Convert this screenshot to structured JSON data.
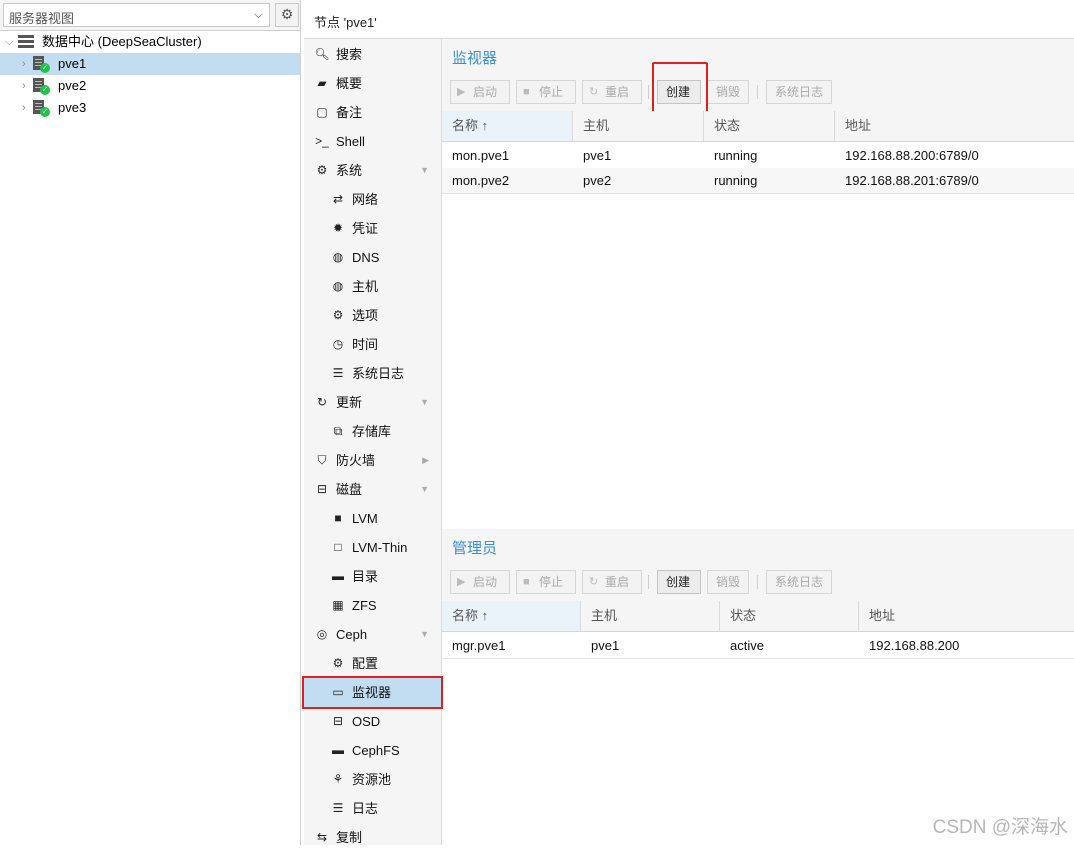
{
  "tree": {
    "view_label": "服务器视图",
    "datacenter": "数据中心 (DeepSeaCluster)",
    "nodes": [
      "pve1",
      "pve2",
      "pve3"
    ]
  },
  "header": {
    "title": "节点 'pve1'"
  },
  "nav": {
    "search": "搜索",
    "summary": "概要",
    "notes": "备注",
    "shell": "Shell",
    "system": "系统",
    "network": "网络",
    "certificates": "凭证",
    "dns": "DNS",
    "hosts": "主机",
    "options": "选项",
    "time": "时间",
    "syslog": "系统日志",
    "updates": "更新",
    "repos": "存储库",
    "firewall": "防火墙",
    "disks": "磁盘",
    "lvm": "LVM",
    "lvmthin": "LVM-Thin",
    "directory": "目录",
    "zfs": "ZFS",
    "ceph": "Ceph",
    "config": "配置",
    "monitor": "监视器",
    "osd": "OSD",
    "cephfs": "CephFS",
    "pools": "资源池",
    "log": "日志",
    "replication": "复制"
  },
  "monitors": {
    "title": "监视器",
    "toolbar": {
      "start": "启动",
      "stop": "停止",
      "restart": "重启",
      "create": "创建",
      "destroy": "销毁",
      "syslog": "系统日志"
    },
    "columns": {
      "name": "名称 ↑",
      "host": "主机",
      "status": "状态",
      "address": "地址"
    },
    "rows": [
      {
        "name": "mon.pve1",
        "host": "pve1",
        "status": "running",
        "address": "192.168.88.200:6789/0"
      },
      {
        "name": "mon.pve2",
        "host": "pve2",
        "status": "running",
        "address": "192.168.88.201:6789/0"
      }
    ]
  },
  "managers": {
    "title": "管理员",
    "toolbar": {
      "start": "启动",
      "stop": "停止",
      "restart": "重启",
      "create": "创建",
      "destroy": "销毁",
      "syslog": "系统日志"
    },
    "columns": {
      "name": "名称 ↑",
      "host": "主机",
      "status": "状态",
      "address": "地址"
    },
    "rows": [
      {
        "name": "mgr.pve1",
        "host": "pve1",
        "status": "active",
        "address": "192.168.88.200"
      }
    ]
  },
  "watermark": "CSDN @深海水"
}
